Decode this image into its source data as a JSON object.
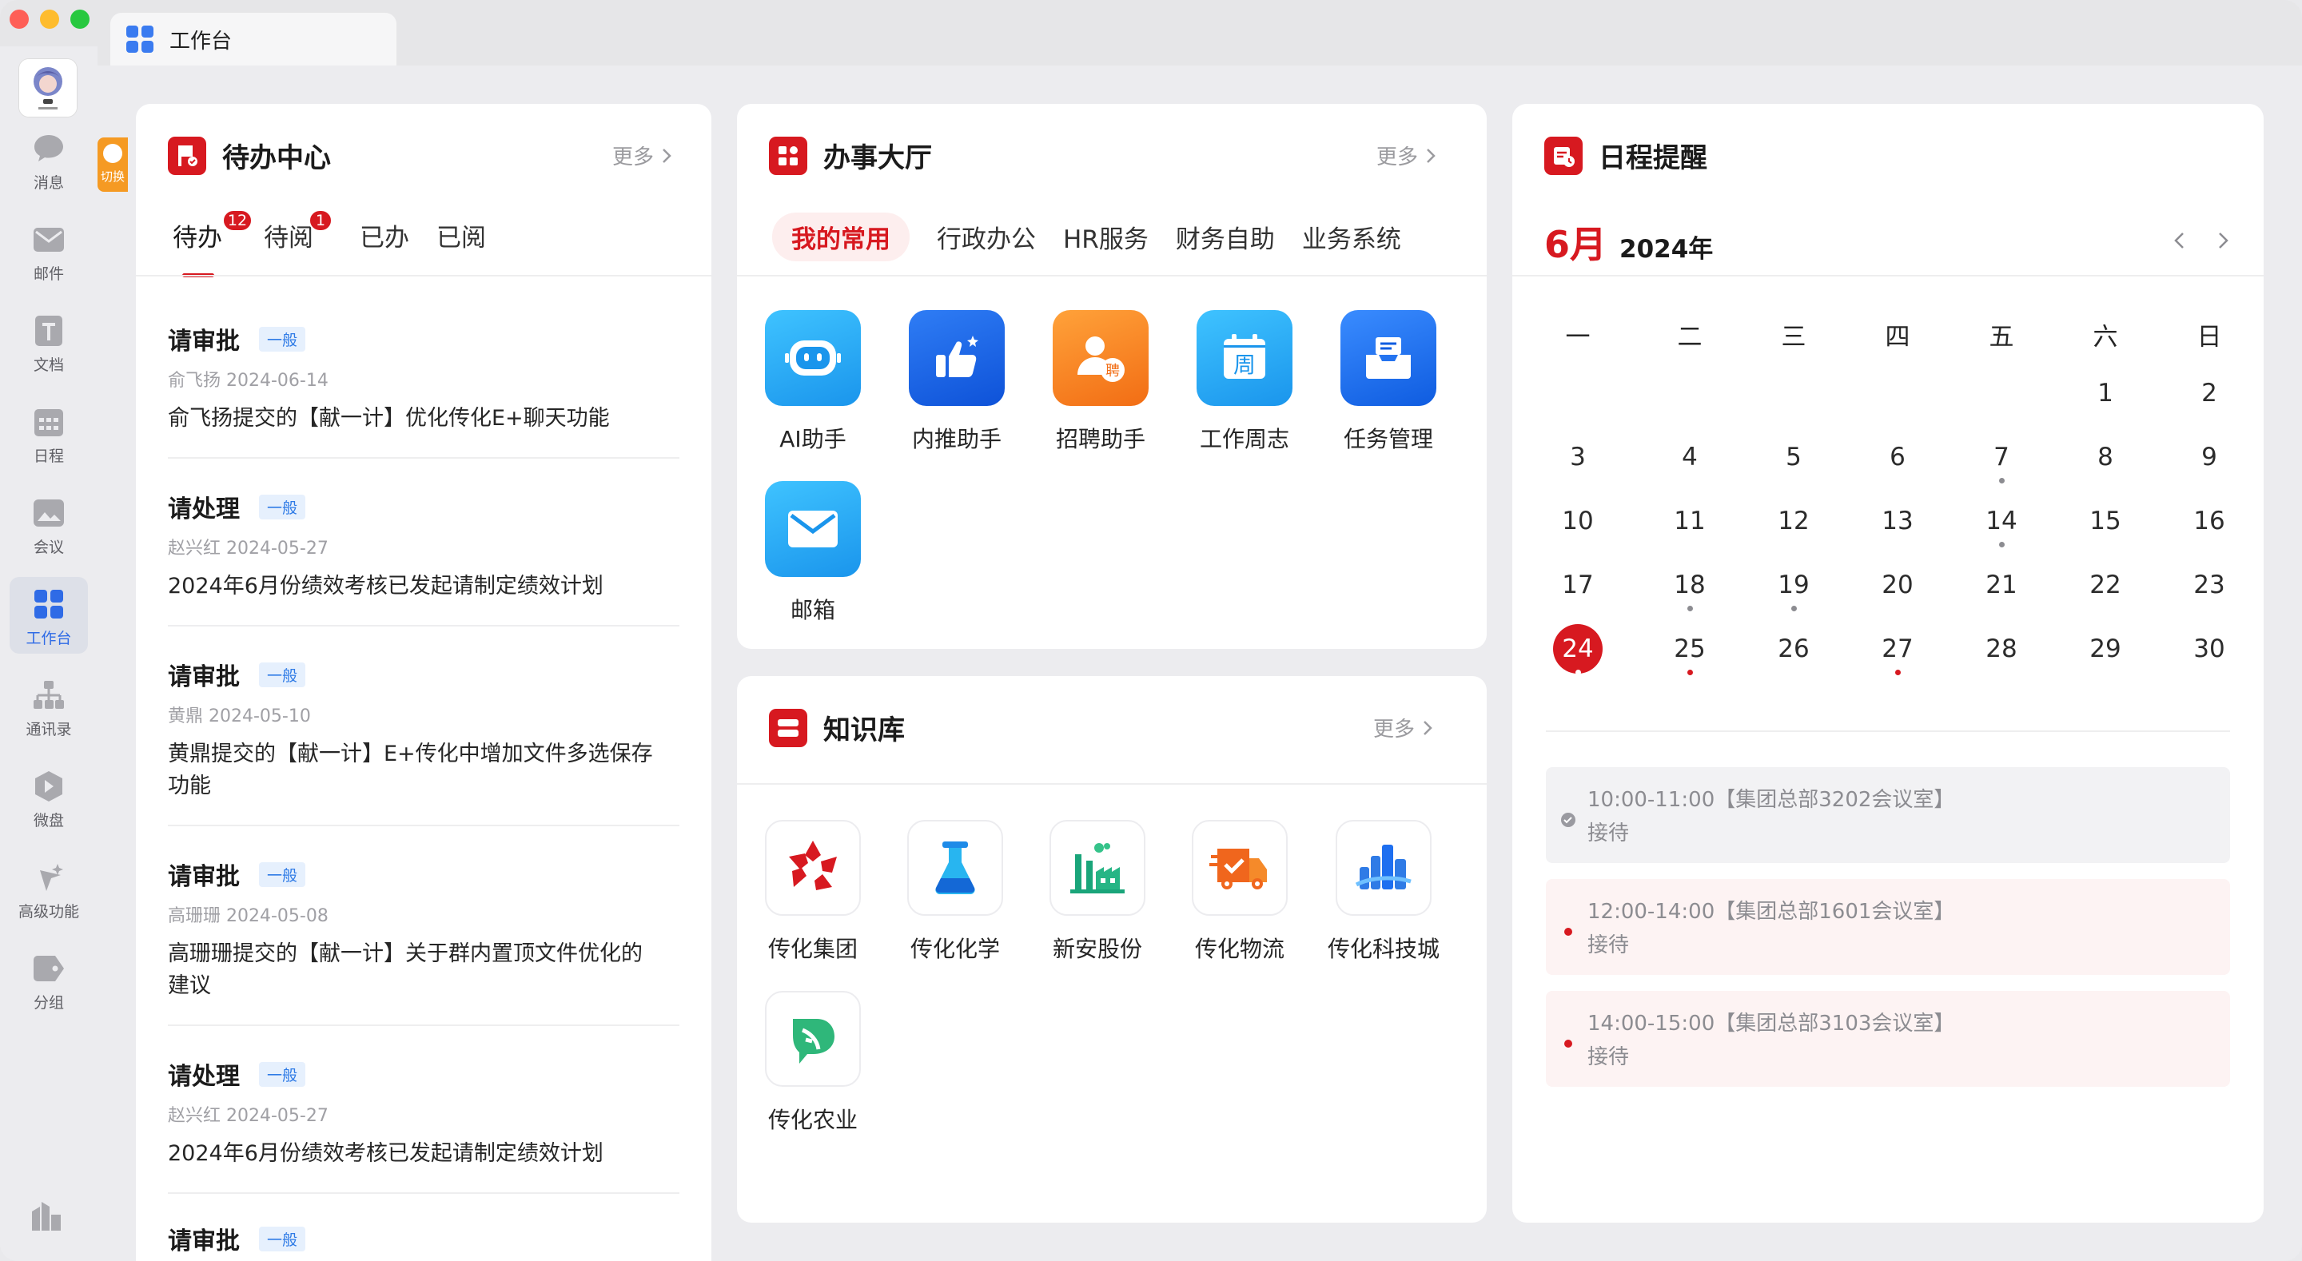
{
  "window": {
    "tab_title": "工作台"
  },
  "sidebar": {
    "items": [
      {
        "label": "消息",
        "icon": "chat-icon"
      },
      {
        "label": "邮件",
        "icon": "mail-icon"
      },
      {
        "label": "文档",
        "icon": "document-icon"
      },
      {
        "label": "日程",
        "icon": "calendar-icon"
      },
      {
        "label": "会议",
        "icon": "meeting-icon"
      },
      {
        "label": "工作台",
        "icon": "workbench-icon",
        "active": true
      },
      {
        "label": "通讯录",
        "icon": "contacts-icon"
      },
      {
        "label": "微盘",
        "icon": "cloud-drive-icon"
      },
      {
        "label": "高级功能",
        "icon": "sparkle-icon"
      },
      {
        "label": "分组",
        "icon": "group-tag-icon"
      }
    ],
    "switch_label": "切换"
  },
  "todo": {
    "title": "待办中心",
    "more": "更多",
    "tabs": [
      {
        "label": "待办",
        "badge": "12"
      },
      {
        "label": "待阅",
        "badge": "1"
      },
      {
        "label": "已办"
      },
      {
        "label": "已阅"
      }
    ],
    "items": [
      {
        "title": "请审批",
        "tag": "一般",
        "meta": "俞飞扬 2024-06-14",
        "desc": "俞飞扬提交的【献一计】优化传化E+聊天功能"
      },
      {
        "title": "请处理",
        "tag": "一般",
        "meta": "赵兴红 2024-05-27",
        "desc": "2024年6月份绩效考核已发起请制定绩效计划"
      },
      {
        "title": "请审批",
        "tag": "一般",
        "meta": "黄鼎 2024-05-10",
        "desc1": "黄鼎提交的【献一计】E+传化中增加文件多选保存",
        "desc2": "功能"
      },
      {
        "title": "请审批",
        "tag": "一般",
        "meta": "高珊珊 2024-05-08",
        "desc1": "高珊珊提交的【献一计】关于群内置顶文件优化的",
        "desc2": "建议"
      },
      {
        "title": "请处理",
        "tag": "一般",
        "meta": "赵兴红 2024-05-27",
        "desc": "2024年6月份绩效考核已发起请制定绩效计划"
      },
      {
        "title": "请审批",
        "tag": "一般"
      }
    ]
  },
  "hall": {
    "title": "办事大厅",
    "more": "更多",
    "tabs": [
      "我的常用",
      "行政办公",
      "HR服务",
      "财务自助",
      "业务系统"
    ],
    "apps": [
      {
        "label": "AI助手",
        "icon": "ai-robot-icon",
        "color": "#1fa8f2"
      },
      {
        "label": "内推助手",
        "icon": "thumbs-up-icon",
        "color": "#1865e6"
      },
      {
        "label": "招聘助手",
        "icon": "recruit-icon",
        "color": "#f5821f"
      },
      {
        "label": "工作周志",
        "icon": "weekly-calendar-icon",
        "color": "#1fa8f2"
      },
      {
        "label": "任务管理",
        "icon": "task-tray-icon",
        "color": "#1e6ff0"
      },
      {
        "label": "邮箱",
        "icon": "mailbox-icon",
        "color": "#1fa8f2"
      }
    ],
    "recruit_glyph": "聘",
    "weekly_glyph": "周"
  },
  "kb": {
    "title": "知识库",
    "more": "更多",
    "items": [
      {
        "label": "传化集团",
        "icon": "transfar-group-logo-icon"
      },
      {
        "label": "传化化学",
        "icon": "chemistry-flask-icon"
      },
      {
        "label": "新安股份",
        "icon": "factory-icon"
      },
      {
        "label": "传化物流",
        "icon": "logistics-truck-icon"
      },
      {
        "label": "传化科技城",
        "icon": "tech-city-buildings-icon"
      },
      {
        "label": "传化农业",
        "icon": "agriculture-leaf-icon"
      }
    ]
  },
  "calendar": {
    "title": "日程提醒",
    "month": "6月",
    "year": "2024年",
    "weekdays": [
      "一",
      "二",
      "三",
      "四",
      "五",
      "六",
      "日"
    ],
    "today": "24",
    "days": [
      "1",
      "2",
      "3",
      "4",
      "5",
      "6",
      "7",
      "8",
      "9",
      "10",
      "11",
      "12",
      "13",
      "14",
      "15",
      "16",
      "17",
      "18",
      "19",
      "20",
      "21",
      "22",
      "23",
      "24",
      "25",
      "26",
      "27",
      "28",
      "29",
      "30"
    ],
    "events": [
      {
        "time": "10:00-11:00【集团总部3202会议室】",
        "desc": "接待",
        "status": "done"
      },
      {
        "time": "12:00-14:00【集团总部1601会议室】",
        "desc": "接待",
        "status": "upcoming"
      },
      {
        "time": "14:00-15:00【集团总部3103会议室】",
        "desc": "接待",
        "status": "upcoming"
      }
    ],
    "colors": {
      "accent": "#d71920",
      "dot_grey": "#8c8c91"
    }
  }
}
